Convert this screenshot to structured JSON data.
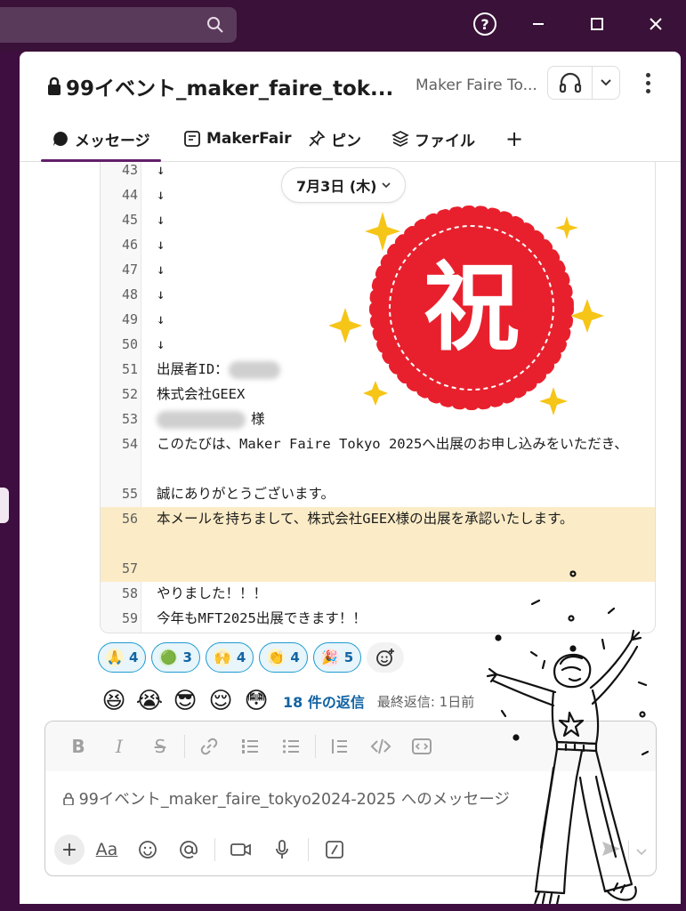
{
  "window": {
    "help": "?"
  },
  "channel": {
    "title": "99イベント_maker_faire_tok...",
    "subtitle": "Maker Faire To..."
  },
  "tabs": [
    {
      "label": "メッセージ"
    },
    {
      "label": "MakerFair"
    },
    {
      "label": "ピン"
    },
    {
      "label": "ファイル"
    },
    {
      "label": "+"
    }
  ],
  "date_pill": {
    "label": "7月3日 (木)"
  },
  "sticker": {
    "kanji": "祝"
  },
  "code_lines": [
    {
      "num": "43",
      "text": "↓"
    },
    {
      "num": "44",
      "text": "↓"
    },
    {
      "num": "45",
      "text": "↓"
    },
    {
      "num": "46",
      "text": "↓"
    },
    {
      "num": "47",
      "text": "↓"
    },
    {
      "num": "48",
      "text": "↓"
    },
    {
      "num": "49",
      "text": "↓"
    },
    {
      "num": "50",
      "text": "↓"
    },
    {
      "num": "51",
      "text": "出展者ID："
    },
    {
      "num": "52",
      "text": "株式会社GEEX"
    },
    {
      "num": "53",
      "text": "様"
    },
    {
      "num": "54",
      "text": "このたびは、Maker Faire Tokyo 2025へ出展のお申し込みをいただき、"
    },
    {
      "num": "55",
      "text": "誠にありがとうございます。"
    },
    {
      "num": "56",
      "text": "本メールを持ちまして、株式会社GEEX様の出展を承認いたします。"
    },
    {
      "num": "57",
      "text": ""
    },
    {
      "num": "58",
      "text": "やりました！！！"
    },
    {
      "num": "59",
      "text": "今年もMFT2025出展できます！！"
    }
  ],
  "reactions": [
    {
      "icon": "pray-hands-icon",
      "count": "4"
    },
    {
      "icon": "green-blob-icon",
      "count": "3"
    },
    {
      "icon": "raised-hands-icon",
      "count": "4"
    },
    {
      "icon": "clap-icon",
      "count": "4"
    },
    {
      "icon": "party-popper-icon",
      "count": "5"
    }
  ],
  "thread": {
    "reply_count": "18 件の返信",
    "last_reply": "最終返信: 1日前"
  },
  "composer": {
    "placeholder": "99イベント_maker_faire_tokyo2024-2025 へのメッセージ",
    "aa_label": "Aa"
  },
  "colors": {
    "aubergine": "#3f0e40",
    "highlight": "#fbecc7",
    "link": "#1264a3",
    "reaction_border": "#1d9bd1",
    "sticker_red": "#e8202d"
  }
}
